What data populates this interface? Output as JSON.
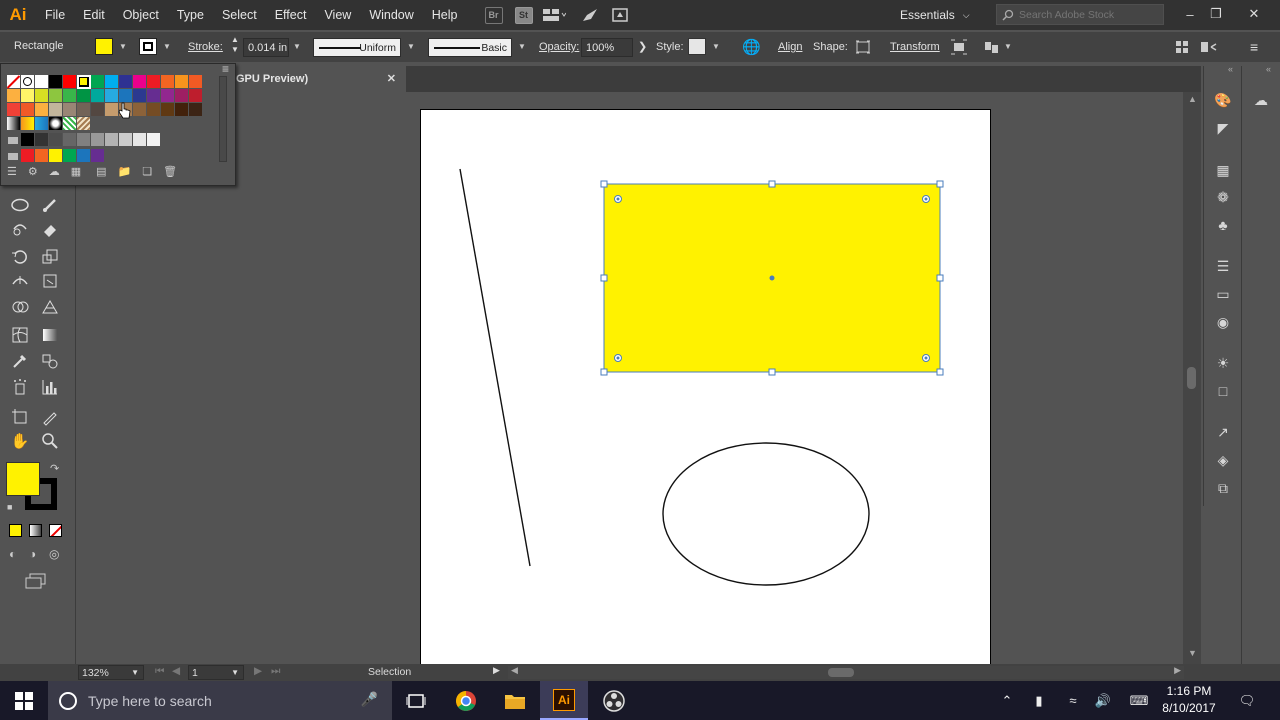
{
  "app": {
    "logo": "Ai"
  },
  "menus": [
    "File",
    "Edit",
    "Object",
    "Type",
    "Select",
    "Effect",
    "View",
    "Window",
    "Help"
  ],
  "menubar_icons": {
    "bridge": "Br",
    "stock": "St"
  },
  "workspace": {
    "label": "Essentials"
  },
  "stock_search": {
    "placeholder": "Search Adobe Stock"
  },
  "control_bar": {
    "object_label": "Rectangle",
    "fill_color": "#fff200",
    "stroke_label": "Stroke:",
    "stroke_weight": "0.014 in",
    "profile_label": "Uniform",
    "brush_label": "Basic",
    "opacity_label": "Opacity:",
    "opacity_value": "100%",
    "style_label": "Style:",
    "align_label": "Align",
    "shape_label": "Shape:",
    "transform_label": "Transform"
  },
  "document_tab": {
    "title": "GPU Preview)",
    "close": "✕"
  },
  "swatches": {
    "rows": [
      [
        "none",
        "registration",
        "#ffffff",
        "#000000",
        "#ff0000",
        "#fff200",
        "#00a651",
        "#00aeef",
        "#2e3192",
        "#ec008c",
        "#ed1c24",
        "#f26522",
        "#f7941d",
        "#f15a24"
      ],
      [
        "#fcb040",
        "#fff568",
        "#d7df23",
        "#8dc63f",
        "#39b54a",
        "#009444",
        "#00a99d",
        "#27aae1",
        "#1c75bc",
        "#2b3990",
        "#662d91",
        "#92278f",
        "#9e1f63",
        "#be1e2d"
      ],
      [
        "#ef4136",
        "#f05a28",
        "#fbb040",
        "#c2b59b",
        "#998675",
        "#736357",
        "#534741",
        "#c69c6d",
        "#a67c52",
        "#8c6239",
        "#754c24",
        "#603913",
        "#42210b",
        "#3c2415"
      ],
      [
        "gradient1",
        "gradient2",
        "gradient3",
        "gradient4",
        "pattern1",
        "pattern2"
      ],
      [
        "folder",
        "#000000",
        "#333333",
        "#4d4d4d",
        "#666666",
        "#808080",
        "#999999",
        "#b3b3b3",
        "#cccccc",
        "#e6e6e6",
        "#f2f2f2"
      ],
      [
        "folder",
        "#ed1c24",
        "#f26522",
        "#fff200",
        "#00a651",
        "#1c75bc",
        "#662d91"
      ]
    ]
  },
  "tools": {
    "fill_color": "#fff200",
    "stroke_color": "#000000"
  },
  "artwork": {
    "rect_fill": "#fff200",
    "selection_color": "#4a7dbd"
  },
  "status_bar": {
    "zoom": "132%",
    "artboard_index": "1",
    "tool_state": "Selection"
  },
  "taskbar": {
    "search_placeholder": "Type here to search",
    "time": "1:16 PM",
    "date": "8/10/2017"
  }
}
